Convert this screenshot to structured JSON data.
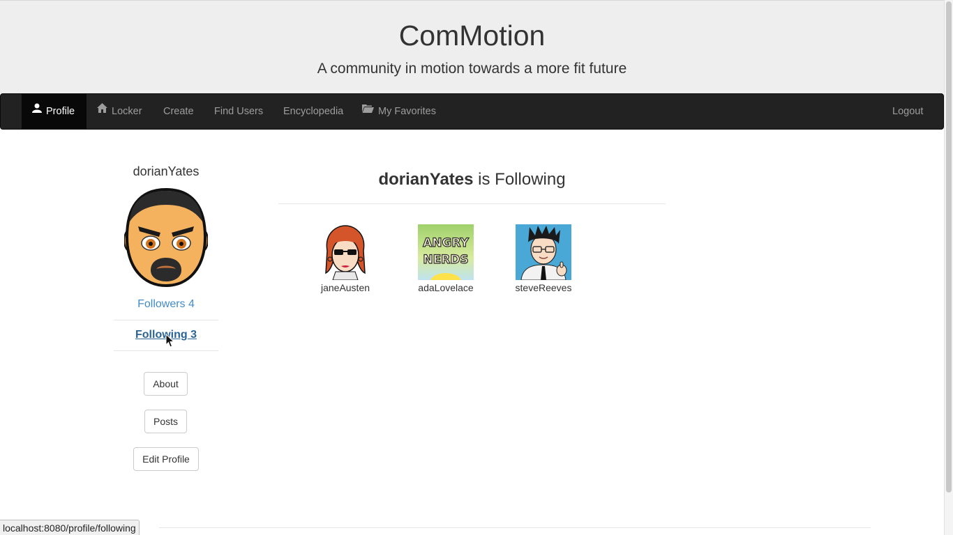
{
  "header": {
    "title": "ComMotion",
    "tagline": "A community in motion towards a more fit future"
  },
  "navbar": {
    "items": [
      {
        "label": "Profile",
        "icon": "user-icon",
        "active": true
      },
      {
        "label": "Locker",
        "icon": "home-icon"
      },
      {
        "label": "Create"
      },
      {
        "label": "Find Users"
      },
      {
        "label": "Encyclopedia"
      },
      {
        "label": "My Favorites",
        "icon": "folder-open-icon"
      }
    ],
    "logout_label": "Logout"
  },
  "sidebar": {
    "username": "dorianYates",
    "followers_label": "Followers 4",
    "following_label": "Following 3",
    "buttons": {
      "about": "About",
      "posts": "Posts",
      "edit_profile": "Edit Profile"
    }
  },
  "main": {
    "heading_user": "dorianYates",
    "heading_suffix": " is Following",
    "following": [
      {
        "username": "janeAusten"
      },
      {
        "username": "adaLovelace",
        "thumb_text_1": "ANGRY",
        "thumb_text_2": "NERDS"
      },
      {
        "username": "steveReeves"
      }
    ]
  },
  "statusbar": {
    "url": "localhost:8080/profile/following"
  },
  "colors": {
    "link": "#428bca",
    "link_hover": "#2a6496",
    "navbar_bg": "#222222",
    "header_bg": "#eeeeee"
  }
}
